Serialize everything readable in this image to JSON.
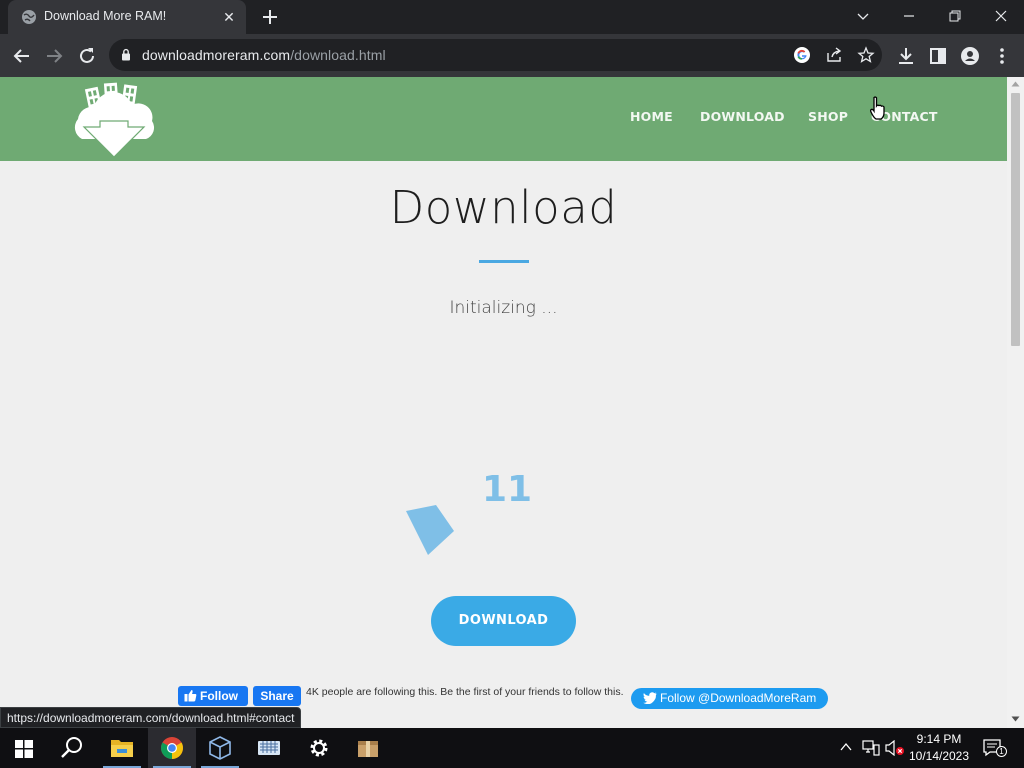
{
  "browser": {
    "tab": {
      "title": "Download More RAM!",
      "close_glyph": "✕"
    },
    "new_tab_glyph": "+",
    "address": {
      "domain": "downloadmoreram.com",
      "path": "/download.html"
    },
    "status_bar_url": "https://downloadmoreram.com/download.html#contact"
  },
  "site": {
    "nav": {
      "home": "HOME",
      "download": "DOWNLOAD",
      "shop": "SHOP",
      "contact": "CONTACT"
    },
    "title": "Download",
    "status": "Initializing ...",
    "counter": "11",
    "download_button": "DOWNLOAD",
    "facebook": {
      "follow": "Follow",
      "share": "Share",
      "text": "4K people are following this. Be the first of your friends to follow this."
    },
    "twitter": {
      "follow": "Follow @DownloadMoreRam"
    }
  },
  "colors": {
    "header_green": "#6faa73",
    "accent_blue": "#3aaae6",
    "counter_blue": "#7fbfe7",
    "facebook_blue": "#1877f2",
    "twitter_blue": "#1d9bf0"
  },
  "taskbar": {
    "apps": [
      "start-icon",
      "search-icon",
      "file-explorer-icon",
      "chrome-icon",
      "virtualbox-icon",
      "keyboard-icon",
      "settings-icon",
      "package-icon"
    ],
    "clock": {
      "time": "9:14 PM",
      "date": "10/14/2023"
    },
    "notification_count": "1"
  }
}
